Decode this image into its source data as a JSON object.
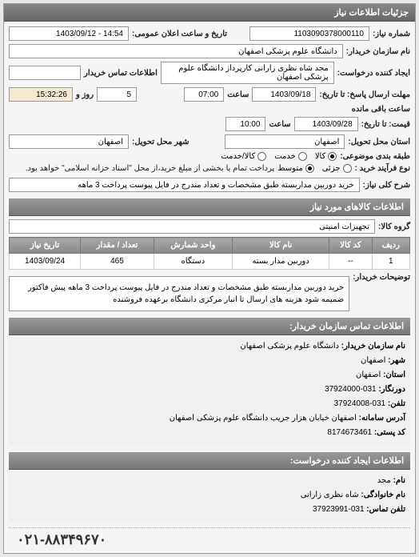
{
  "header": {
    "title": "جزئیات اطلاعات نیاز"
  },
  "fields": {
    "request_no_label": "شماره نیاز:",
    "request_no": "1103090378000110",
    "public_date_label": "تاریخ و ساعت اعلان عمومی:",
    "public_date": "14:54 - 1403/09/12",
    "buyer_name_label": "نام سازمان خریدار:",
    "buyer_name": "دانشگاه علوم پزشکی اصفهان",
    "requester_label": "ایجاد کننده درخواست:",
    "requester": "مجد شاه نظری زارانی کارپرداز دانشگاه علوم پزشکی اصفهان",
    "buyer_contact_label": "اطلاعات تماس خریدار",
    "buyer_contact": "",
    "response_deadline_label": "مهلت ارسال پاسخ: تا تاریخ:",
    "response_deadline_date": "1403/09/18",
    "time_label": "ساعت",
    "response_deadline_time": "07:00",
    "days_label": "روز و",
    "days_value": "5",
    "remaining_label": "ساعت باقی مانده",
    "remaining_time": "15:32:26",
    "quote_until_label": "قیمت: تا تاریخ:",
    "quote_until_date": "1403/09/28",
    "quote_until_time": "10:00",
    "delivery_state_label": "استان محل تحویل:",
    "delivery_state": "اصفهان",
    "delivery_city_label": "شهر محل تحویل:",
    "delivery_city": "اصفهان",
    "category_label": "طبقه بندی موضوعی:",
    "cat_goods": "کالا",
    "cat_service": "خدمت",
    "cat_both": "کالا/خدمت",
    "purchase_type_label": "نوع فرآیند خرید :",
    "pt_small": "جزئی",
    "pt_medium": "متوسط",
    "purchase_note": "پرداخت تمام یا بخشی از مبلغ خرید،از محل \"اسناد خزانه اسلامی\" خواهد بود.",
    "need_title_label": "شرح کلی نیاز:",
    "need_title": "خرید دوربین مداربسته طبق مشخصات و تعداد مندرج در فایل پیوست پرداخت 3 ماهه"
  },
  "goods_section": {
    "header": "اطلاعات کالاهای مورد نیاز",
    "group_label": "گروه کالا:",
    "group_value": "تجهیزات امنیتی"
  },
  "table": {
    "headers": {
      "row": "ردیف",
      "code": "کد کالا",
      "name": "نام کالا",
      "unit": "واحد شمارش",
      "qty": "تعداد / مقدار",
      "date": "تاریخ نیاز"
    },
    "rows": [
      {
        "row": "1",
        "code": "--",
        "name": "دوربین مدار بسته",
        "unit": "دستگاه",
        "qty": "465",
        "date": "1403/09/24"
      }
    ]
  },
  "description": {
    "label": "توضیحات خریدار:",
    "text": "خرید دوربین مداربسته طبق مشخصات و تعداد مندرج در فایل پیوست پرداخت 3 ماهه پیش فاکتور ضمیمه شود هزینه های ارسال تا انبار مرکزی دانشگاه برعهده فروشنده"
  },
  "contact_section": {
    "header": "اطلاعات تماس سازمان خریدار:",
    "org_label": "نام سازمان خریدار:",
    "org": "دانشگاه علوم پزشکی اصفهان",
    "city_label": "شهر:",
    "city": "اصفهان",
    "state_label": "استان:",
    "state": "اصفهان",
    "fax_label": "دورنگار:",
    "fax": "031-37924000",
    "phone_label": "تلفن:",
    "phone": "031-37924008",
    "address_label": "آدرس سامانه:",
    "address": "اصفهان خیابان هزار جریب دانشگاه علوم پزشکی اصفهان",
    "postal_label": "کد پستی:",
    "postal": "8174673461"
  },
  "creator_section": {
    "header": "اطلاعات ایجاد کننده درخواست:",
    "name_label": "نام:",
    "name": "مجد",
    "family_label": "نام خانوادگی:",
    "family": "شاه نظری زارانی",
    "phone_label": "تلفن تماس:",
    "phone": "031-37923991"
  },
  "footer_phone": "۰۲۱-۸۸۳۴۹۶۷۰"
}
